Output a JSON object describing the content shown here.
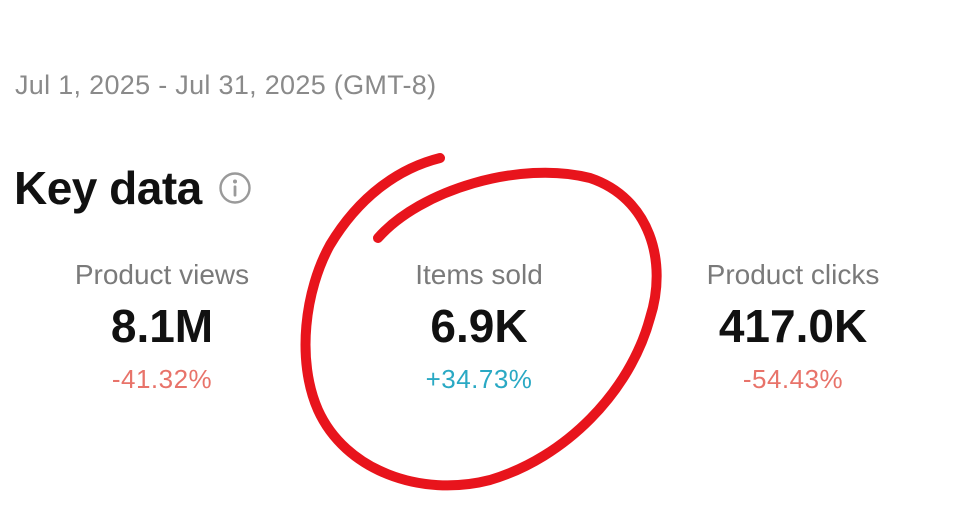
{
  "date_range": "Jul 1, 2025 - Jul 31, 2025 (GMT-8)",
  "section": {
    "title": "Key data",
    "info_icon": "info-circle-icon"
  },
  "metrics": [
    {
      "label": "Product views",
      "value": "8.1M",
      "change": "-41.32%",
      "trend": "down"
    },
    {
      "label": "Items sold",
      "value": "6.9K",
      "change": "+34.73%",
      "trend": "up"
    },
    {
      "label": "Product clicks",
      "value": "417.0K",
      "change": "-54.43%",
      "trend": "down"
    }
  ],
  "colors": {
    "negative": "#e8736a",
    "positive": "#2aa9c4",
    "annotation": "#e8141c"
  },
  "annotation": {
    "type": "hand-drawn circle",
    "highlights": "Items sold"
  }
}
